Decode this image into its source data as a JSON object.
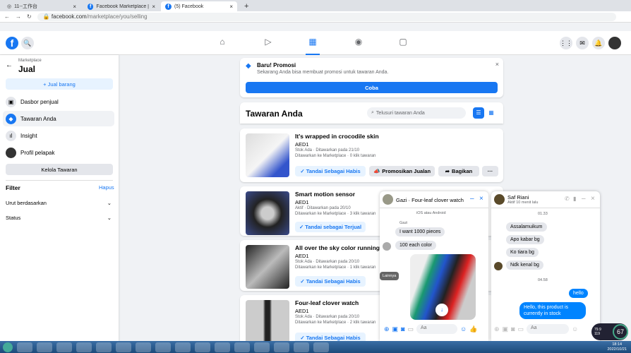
{
  "browser": {
    "tabs": [
      {
        "title": "11--工作台"
      },
      {
        "title": "Facebook Marketplace | Faceb"
      },
      {
        "title": "(5) Facebook"
      }
    ],
    "url_host": "facebook.com",
    "url_path": "/marketplace/you/selling"
  },
  "header": {
    "logo": "f",
    "nav_icons": [
      "home-icon",
      "video-icon",
      "marketplace-icon",
      "groups-icon",
      "gaming-icon"
    ],
    "active_nav": "marketplace-icon"
  },
  "sidebar": {
    "breadcrumb": "Marketplace",
    "title": "Jual",
    "sell_button": "+ Jual barang",
    "items": [
      {
        "label": "Dasbor penjual",
        "icon": "dashboard-icon"
      },
      {
        "label": "Tawaran Anda",
        "icon": "tag-icon",
        "active": true
      },
      {
        "label": "Insight",
        "icon": "chart-icon"
      },
      {
        "label": "Profil pelapak",
        "icon": "profile-icon"
      }
    ],
    "manage_button": "Kelola Tawaran",
    "filter_label": "Filter",
    "filter_clear": "Hapus",
    "sort_label": "Urut berdasarkan",
    "status_label": "Status"
  },
  "promo": {
    "title": "Baru! Promosi",
    "text": "Sekarang Anda bisa membuat promosi untuk tawaran Anda.",
    "button": "Coba"
  },
  "listings_header": {
    "title": "Tawaran Anda",
    "search_placeholder": "Telusuri tawaran Anda"
  },
  "listings": [
    {
      "title": "It's wrapped in crocodile skin",
      "price": "AED1",
      "meta1": "Stok Ada · Ditawarkan pada 21/10",
      "meta2": "Ditawarkan ke Marketplace · 0 klik tawaran",
      "mark": "✓ Tandai Sebagai Habis",
      "promote": "Promosikan Jualan",
      "share": "Bagikan",
      "more": "···"
    },
    {
      "title": "Smart motion sensor",
      "price": "AED1",
      "meta1": "Aktif · Ditawarkan pada 20/10",
      "meta2": "Ditawarkan ke Marketplace · 3 klik tawaran",
      "mark": "✓ Tandai sebagai Terjual"
    },
    {
      "title": "All over the sky color running sho",
      "price": "AED1",
      "meta1": "Stok Ada · Ditawarkan pada 20/10",
      "meta2": "Ditawarkan ke Marketplace · 1 klik tawaran",
      "mark": "✓ Tandai Sebagai Habis"
    },
    {
      "title": "Four-leaf clover watch",
      "price": "AED1",
      "meta1": "Stok Ada · Ditawarkan pada 20/10",
      "meta2": "Ditawarkan ke Marketplace · 2 klik tawaran",
      "mark": "✓ Tandai Sebagai Habis"
    }
  ],
  "chat1": {
    "title": "Gazi · Four-leaf clover watch",
    "top_note": "iOS atau Android",
    "sender": "Gazi",
    "messages": [
      "I want 1000 pieces",
      "100 each color"
    ],
    "tooltip": "Lainnya",
    "input_placeholder": "Aa"
  },
  "chat2": {
    "name": "Saf Riani",
    "status": "Aktif 10 menit lalu",
    "time1": "01.33",
    "messages_in": [
      "Assalamuikum",
      "Apo kabar bg",
      "Ko tiara bg",
      "Ndk kenal bg"
    ],
    "time2": "04.58",
    "messages_out": [
      "hello",
      "Hello, this product is currently in stock"
    ],
    "input_placeholder": "Aa"
  },
  "system": {
    "meter_percent": "67",
    "meter_up": "79.9",
    "meter_down": "119",
    "clock_time": "18:14",
    "clock_date": "2022/10/21"
  }
}
